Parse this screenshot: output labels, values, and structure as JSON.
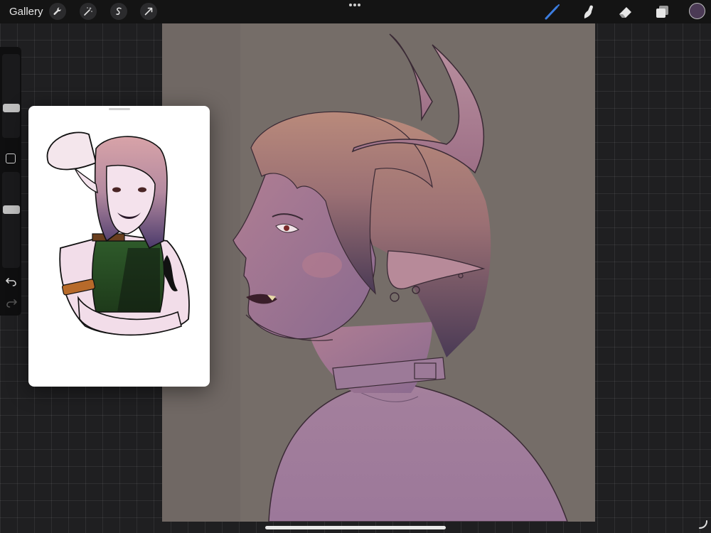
{
  "topbar": {
    "gallery_label": "Gallery",
    "left_tools": [
      "wrench-icon",
      "magic-wand-icon",
      "selection-icon",
      "transform-arrow-icon"
    ],
    "right_tools": [
      "brush-icon",
      "smudge-icon",
      "eraser-icon",
      "layers-icon"
    ],
    "active_tool": "brush-icon",
    "current_color": "#4b3a55",
    "accent_color": "#3c7de0"
  },
  "sidebar": {
    "brush_size_level": 0.34,
    "opacity_level": 0.62,
    "icons": [
      "modify-square-icon",
      "undo-icon",
      "redo-icon"
    ]
  },
  "canvas": {
    "background_color": "#756d68",
    "artwork": "horned-character-profile-sketch"
  },
  "reference_window": {
    "content": "reference-character-illustration",
    "background_color": "#ffffff"
  }
}
